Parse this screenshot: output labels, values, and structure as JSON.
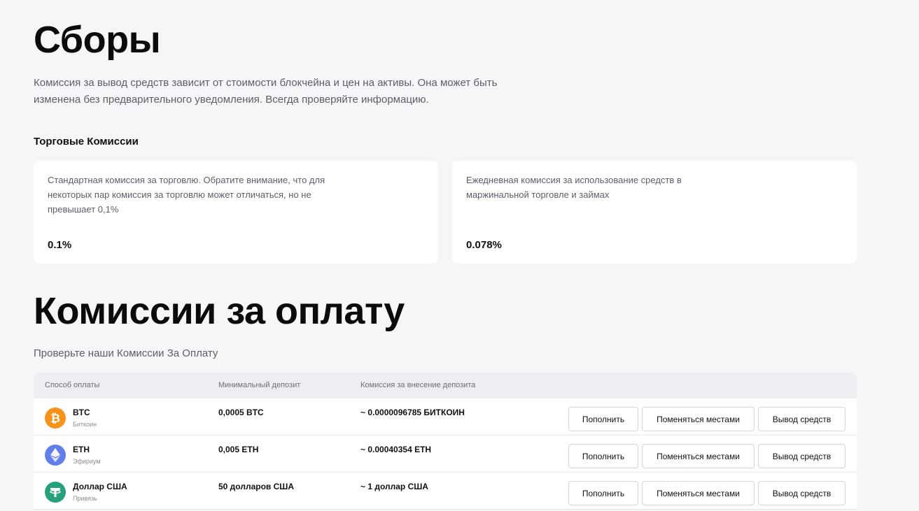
{
  "fees": {
    "title": "Сборы",
    "description": "Комиссия за вывод средств зависит от стоимости блокчейна и цен на активы. Она может быть изменена без предварительного уведомления. Всегда проверяйте информацию.",
    "subheading": "Торговые Комиссии",
    "cards": [
      {
        "text": "Стандартная комиссия за торговлю. Обратите внимание, что для некоторых пар комиссия за торговлю может отличаться, но не превышает 0,1%",
        "value": "0.1%"
      },
      {
        "text": "Ежедневная комиссия за использование средств в маржинальной торговле и займах",
        "value": "0.078%"
      }
    ]
  },
  "payments": {
    "title": "Комиссии за оплату",
    "subtitle": "Проверьте наши Комиссии За Оплату",
    "columns": [
      "Способ оплаты",
      "Минимальный депозит",
      "Комиссия за внесение депозита"
    ],
    "rows": [
      {
        "symbol": "BTC",
        "name": "Биткоин",
        "min_deposit": "0,0005 BTC",
        "fee": "~ 0.0000096785 БИТКОИН",
        "icon": "bitcoin-icon",
        "color": "#f7931a"
      },
      {
        "symbol": "ETH",
        "name": "Эфириум",
        "min_deposit": "0,005 ETH",
        "fee": "~ 0.00040354 ETH",
        "icon": "ethereum-icon",
        "color": "#627eea"
      },
      {
        "symbol": "Доллар США",
        "name": "Привязь",
        "min_deposit": "50 долларов США",
        "fee": "~ 1 доллар США",
        "icon": "tether-icon",
        "color": "#26a17b"
      }
    ],
    "buttons": {
      "deposit": "Пополнить",
      "swap": "Поменяться местами",
      "withdraw": "Вывод средств"
    }
  }
}
